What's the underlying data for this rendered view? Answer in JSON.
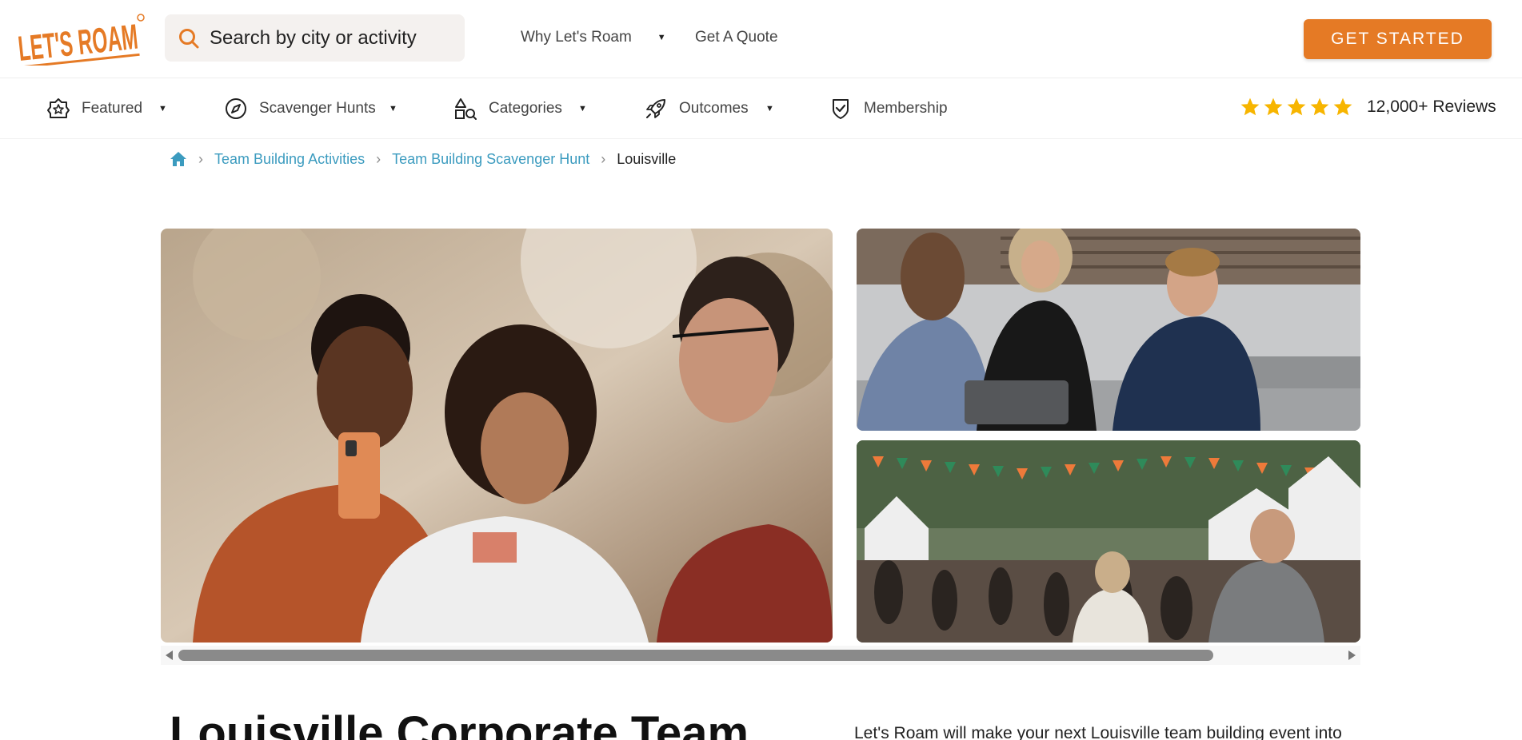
{
  "header": {
    "logo_text": "LET'S ROAM",
    "search_placeholder": "Search by city or activity",
    "nav": [
      {
        "label": "Why Let's Roam",
        "has_dropdown": true
      },
      {
        "label": "Get A Quote",
        "has_dropdown": false
      }
    ],
    "cta_label": "GET STARTED"
  },
  "subnav": {
    "items": [
      {
        "label": "Featured",
        "icon": "badge-star-icon"
      },
      {
        "label": "Scavenger Hunts",
        "icon": "compass-icon"
      },
      {
        "label": "Categories",
        "icon": "shapes-icon"
      },
      {
        "label": "Outcomes",
        "icon": "rocket-icon"
      },
      {
        "label": "Membership",
        "icon": "shield-check-icon"
      }
    ],
    "rating_stars": 5,
    "reviews_label": "12,000+ Reviews"
  },
  "breadcrumb": {
    "items": [
      "Team Building Activities",
      "Team Building Scavenger Hunt"
    ],
    "current": "Louisville"
  },
  "gallery": {
    "images": [
      {
        "alt": "Three friends looking at a phone outdoors"
      },
      {
        "alt": "Group of coworkers chatting on steps"
      },
      {
        "alt": "Crowded outdoor festival with bunting"
      }
    ]
  },
  "content": {
    "headline": "Louisville Corporate Team",
    "intro": "Let's Roam will make your next Louisville team building event into"
  },
  "colors": {
    "brand_orange": "#e57a25",
    "link_blue": "#3b9bbf",
    "star_yellow": "#f7b500"
  }
}
